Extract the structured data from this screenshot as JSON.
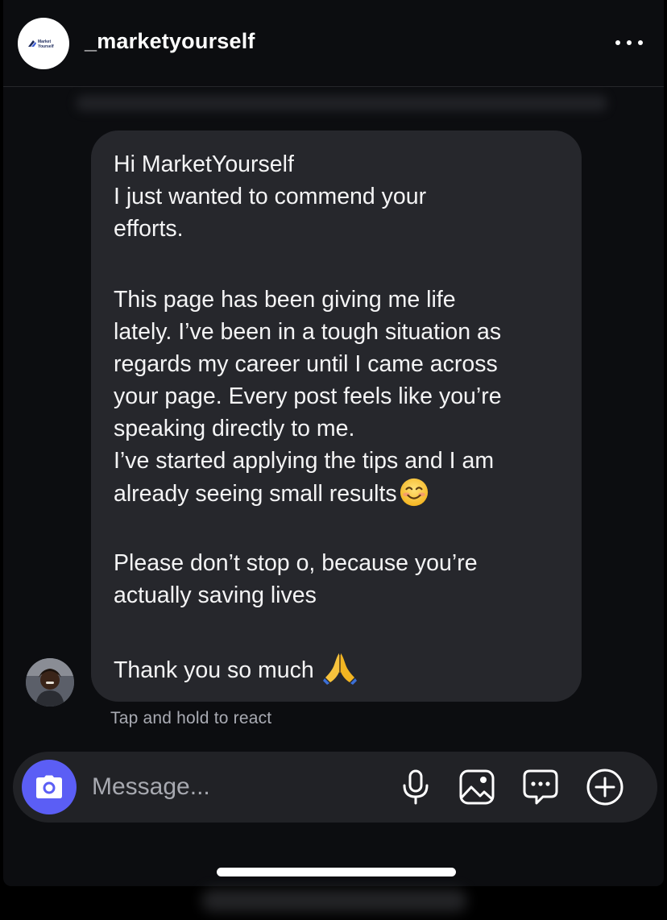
{
  "header": {
    "username": "_marketyourself",
    "logo_text": [
      "Market",
      "Yourself"
    ],
    "more_icon": "more-horizontal-icon"
  },
  "message": {
    "lines": [
      "Hi MarketYourself",
      "I just wanted to commend your",
      "efforts.",
      "This page has been giving me life",
      "lately. I’ve been in a tough situation as",
      "regards my career until I came across",
      "your page. Every post feels like you’re",
      "speaking directly to me.",
      "I’ve started applying the tips and I am",
      "already seeing small results",
      "Please don’t stop o, because you’re",
      "actually saving lives",
      "Thank you so much"
    ],
    "emoji_after_results": "smiling-face-icon",
    "emoji_after_thanks": "folded-hands-icon"
  },
  "hint": "Tap and hold to react",
  "composer": {
    "placeholder": "Message...",
    "icons": [
      "camera-icon",
      "microphone-icon",
      "gallery-icon",
      "sticker-chat-icon",
      "plus-circle-icon"
    ]
  },
  "colors": {
    "background": "#0c0d10",
    "bubble": "#26272c",
    "camera_button": "#5b5ef5",
    "hint_text": "#a9abb3"
  }
}
